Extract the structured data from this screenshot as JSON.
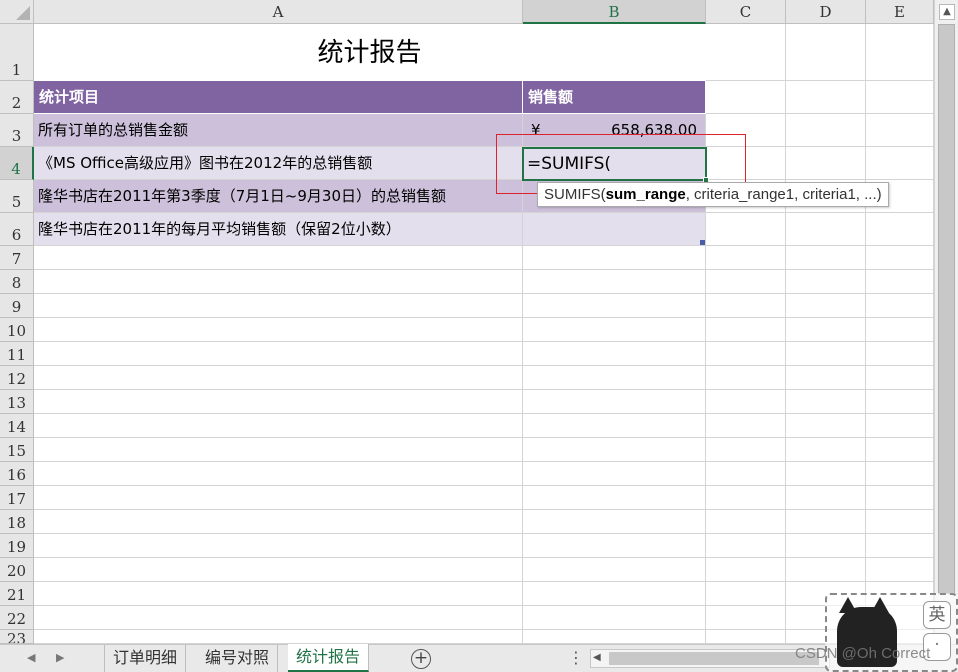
{
  "columns": [
    "A",
    "B",
    "C",
    "D",
    "E"
  ],
  "rows": [
    "1",
    "2",
    "3",
    "4",
    "5",
    "6",
    "7",
    "8",
    "9",
    "10",
    "11",
    "12",
    "13",
    "14",
    "15",
    "16",
    "17",
    "18",
    "19",
    "20",
    "21",
    "22",
    "23"
  ],
  "sheet": {
    "title": "统计报告",
    "header_item": "统计项目",
    "header_sales": "销售额",
    "rows": [
      {
        "label": "所有订单的总销售金额",
        "currency": "¥",
        "value": "658,638.00"
      },
      {
        "label": "《MS Office高级应用》图书在2012年的总销售额",
        "value": "=SUMIFS("
      },
      {
        "label": "隆华书店在2011年第3季度（7月1日~9月30日）的总销售额",
        "value": ""
      },
      {
        "label": "隆华书店在2011年的每月平均销售额（保留2位小数）",
        "value": ""
      }
    ]
  },
  "tooltip": {
    "prefix": "SUMIFS(",
    "bold_arg": "sum_range",
    "rest": ", criteria_range1, criteria1, ...)"
  },
  "tabs": [
    "订单明细",
    "编号对照",
    "统计报告"
  ],
  "active_tab": "统计报告",
  "ime": {
    "lang": "英",
    "dot": "·"
  },
  "watermark": "CSDN @Oh Correct",
  "colors": {
    "header_purple": "#8064a2",
    "row_light_purple": "#ccc0da",
    "row_lighter_purple": "#e4dfec",
    "excel_green": "#217346"
  }
}
